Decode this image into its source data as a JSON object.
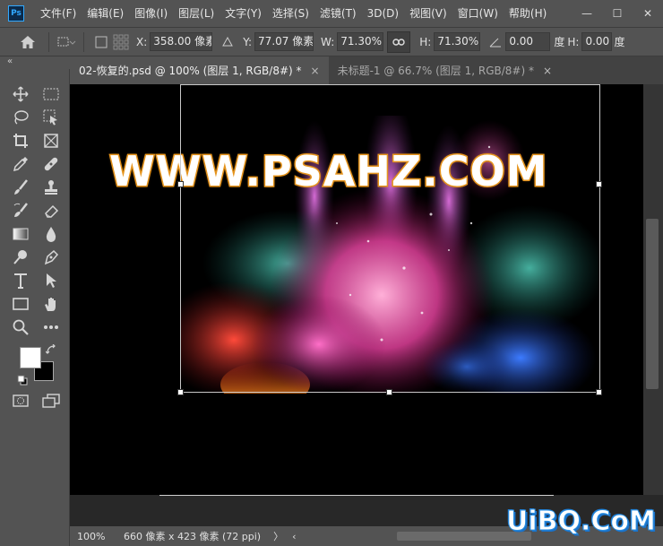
{
  "app": {
    "logo_text": "Ps"
  },
  "menu": [
    "文件(F)",
    "编辑(E)",
    "图像(I)",
    "图层(L)",
    "文字(Y)",
    "选择(S)",
    "滤镜(T)",
    "3D(D)",
    "视图(V)",
    "窗口(W)",
    "帮助(H)"
  ],
  "window_controls": {
    "minimize": "—",
    "maximize": "☐",
    "close": "✕"
  },
  "options": {
    "x_label": "X:",
    "x_value": "358.00 像素",
    "y_label": "Y:",
    "y_value": "77.07 像素",
    "w_label": "W:",
    "w_value": "71.30%",
    "h_label": "H:",
    "h_value": "71.30%",
    "angle_value": "0.00",
    "angle_unit": "度",
    "hskew_label": "H:",
    "hskew_value": "0.00",
    "hskew_unit": "度"
  },
  "panel_toggle": "«",
  "tabs": [
    {
      "label": "02-恢复的.psd @ 100% (图层 1, RGB/8#) *",
      "active": true,
      "close": "×"
    },
    {
      "label": "未标题-1 @ 66.7% (图层 1, RGB/8#) *",
      "active": false,
      "close": "×"
    }
  ],
  "canvas": {
    "watermark_text": "WWW.PSAHZ.COM",
    "watermark_color": "#e6951e"
  },
  "status": {
    "zoom": "100%",
    "doc_info": "660 像素 x 423 像素 (72 ppi)",
    "arrow": "〉",
    "scroll_left": "‹"
  },
  "site_watermark": "UiBQ.CoM",
  "colors": {
    "ui_bg": "#535353",
    "canvas_bg": "#282828",
    "accent": "#31a8ff"
  }
}
